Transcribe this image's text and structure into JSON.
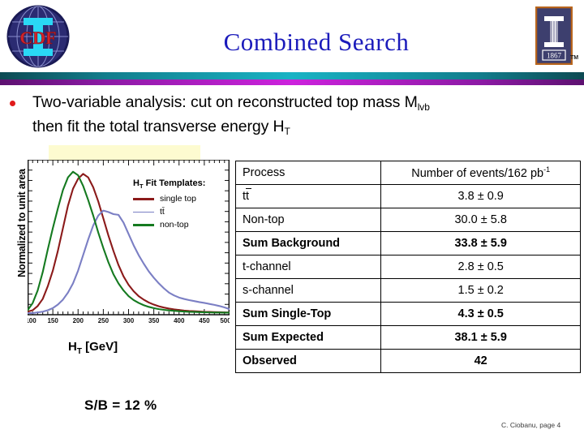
{
  "header": {
    "title": "Combined Search",
    "left_logo": "cdf-run2-logo",
    "right_logo": "university-of-illinois-logo",
    "right_logo_year": "1867",
    "trademark": "TM",
    "accent_teal": "#19b3c4",
    "accent_purple": "#cc22dd",
    "title_color": "#1b1bbb"
  },
  "bullet": {
    "marker_color": "#e01b1b",
    "line1_a": "Two-variable analysis: cut on reconstructed top mass M",
    "line1_sub": "lvb",
    "line2_a": "then fit the total transverse energy H",
    "line2_sub": "T"
  },
  "plot": {
    "ylabel": "Normalized to unit area",
    "xlabel_main": "H",
    "xlabel_sub": "T",
    "xlabel_unit": " [GeV]",
    "legend_title_main": "H",
    "legend_title_sub": "T",
    "legend_title_rest": " Fit Templates:",
    "sb_text": "S/B = 12 %",
    "highlight_color": "#fdfbd0"
  },
  "chart_data": {
    "type": "line",
    "title": "H_T Fit Templates",
    "xlabel": "H_T [GeV]",
    "ylabel": "Normalized to unit area",
    "xlim": [
      100,
      500
    ],
    "ylim": [
      0,
      1.05
    ],
    "xticks": [
      100,
      150,
      200,
      250,
      300,
      350,
      400,
      450,
      500
    ],
    "grid": false,
    "legend_position": "upper-right",
    "x": [
      100,
      110,
      120,
      130,
      140,
      150,
      160,
      170,
      180,
      190,
      200,
      210,
      220,
      230,
      240,
      250,
      260,
      270,
      280,
      290,
      300,
      310,
      320,
      330,
      340,
      350,
      360,
      370,
      380,
      390,
      400,
      410,
      420,
      430,
      440,
      450,
      460,
      470,
      480,
      490,
      500
    ],
    "series": [
      {
        "name": "single top",
        "color": "#8b1a1a",
        "values": [
          0.01,
          0.02,
          0.05,
          0.1,
          0.19,
          0.3,
          0.44,
          0.6,
          0.76,
          0.88,
          0.95,
          0.985,
          0.96,
          0.89,
          0.79,
          0.67,
          0.55,
          0.44,
          0.34,
          0.26,
          0.2,
          0.155,
          0.12,
          0.095,
          0.075,
          0.06,
          0.048,
          0.039,
          0.032,
          0.026,
          0.022,
          0.018,
          0.015,
          0.013,
          0.011,
          0.009,
          0.008,
          0.007,
          0.006,
          0.005,
          0.004
        ]
      },
      {
        "name": "ttbar",
        "color": "#7b7fc4",
        "values": [
          0.0,
          0.0,
          0.005,
          0.01,
          0.02,
          0.035,
          0.06,
          0.095,
          0.145,
          0.21,
          0.3,
          0.41,
          0.52,
          0.62,
          0.69,
          0.725,
          0.715,
          0.7,
          0.695,
          0.64,
          0.56,
          0.48,
          0.41,
          0.35,
          0.295,
          0.25,
          0.21,
          0.175,
          0.145,
          0.125,
          0.11,
          0.1,
          0.092,
          0.085,
          0.078,
          0.072,
          0.065,
          0.058,
          0.05,
          0.04,
          0.028
        ]
      },
      {
        "name": "non-top",
        "color": "#157a20",
        "values": [
          0.02,
          0.07,
          0.16,
          0.29,
          0.45,
          0.6,
          0.74,
          0.87,
          0.96,
          1.0,
          0.975,
          0.9,
          0.8,
          0.69,
          0.57,
          0.46,
          0.36,
          0.275,
          0.21,
          0.16,
          0.12,
          0.092,
          0.072,
          0.056,
          0.044,
          0.035,
          0.028,
          0.023,
          0.019,
          0.016,
          0.013,
          0.011,
          0.009,
          0.008,
          0.007,
          0.006,
          0.005,
          0.004,
          0.004,
          0.003,
          0.003
        ]
      }
    ],
    "legend_labels": [
      "single top",
      "tt̄",
      "non-top"
    ]
  },
  "table": {
    "headers": [
      "Process",
      "Number of events/162 pb",
      "-1"
    ],
    "rows": [
      {
        "process": "tt",
        "value": "3.8 ± 0.9",
        "style": "plain",
        "overline": true
      },
      {
        "process": "Non-top",
        "value": "30.0 ± 5.8",
        "style": "plain"
      },
      {
        "process": "Sum Background",
        "value": "33.8 ± 5.9",
        "style": "green"
      },
      {
        "process": "t-channel",
        "value": "2.8 ± 0.5",
        "style": "plain"
      },
      {
        "process": "s-channel",
        "value": "1.5 ± 0.2",
        "style": "plain"
      },
      {
        "process": "Sum Single-Top",
        "value": "4.3 ± 0.5",
        "style": "red"
      },
      {
        "process": "Sum Expected",
        "value": "38.1 ± 5.9",
        "style": "bold"
      },
      {
        "process": "Observed",
        "value": "42",
        "style": "blue"
      }
    ]
  },
  "footer": {
    "text": "C. Ciobanu,  page 4"
  }
}
